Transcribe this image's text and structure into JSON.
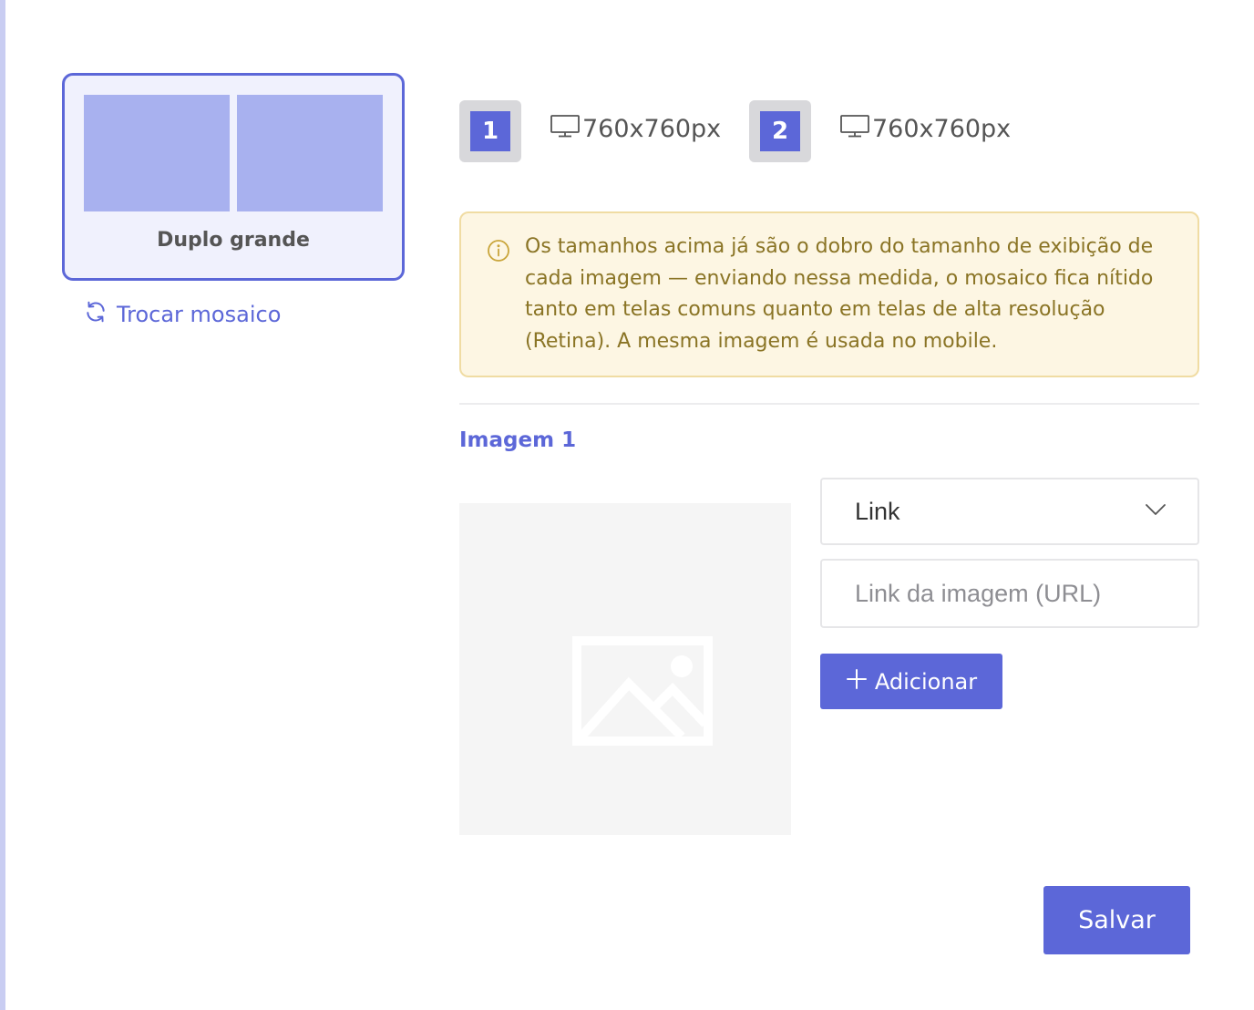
{
  "mosaic": {
    "label": "Duplo grande",
    "swap_link_label": "Trocar mosaico"
  },
  "sizes": [
    {
      "number": "1",
      "icon": "monitor-icon",
      "size": "760x760px"
    },
    {
      "number": "2",
      "icon": "monitor-icon",
      "size": "760x760px"
    }
  ],
  "info": {
    "icon": "info-icon",
    "text": "Os tamanhos acima já são o dobro do tamanho de exibição de cada imagem — enviando nessa medida, o mosaico fica nítido tanto em telas comuns quanto em telas de alta resolução (Retina). A mesma imagem é usada no mobile."
  },
  "image_section": {
    "title": "Imagem 1",
    "placeholder_icon": "image-placeholder-icon",
    "link_type_select": {
      "value": "Link"
    },
    "url_input": {
      "value": "",
      "placeholder": "Link da imagem (URL)"
    },
    "add_button_label": "Adicionar"
  },
  "save_button_label": "Salvar",
  "colors": {
    "accent": "#5c67d8",
    "tile": "#a8b1ef",
    "card_bg": "#f0f1fd",
    "info_bg": "#fdf6e3",
    "info_border": "#f0dca3",
    "info_text": "#8a7425"
  }
}
